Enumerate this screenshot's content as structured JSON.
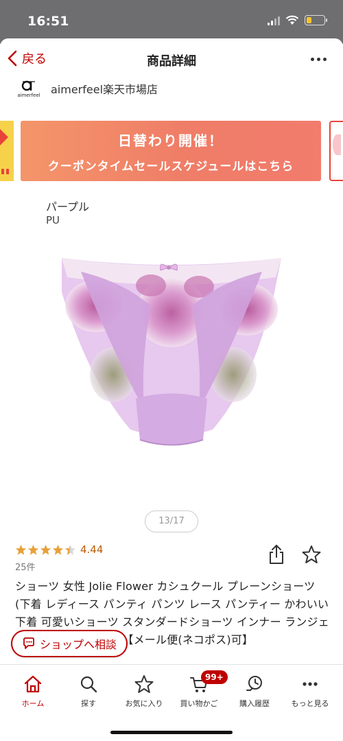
{
  "status_bar": {
    "time": "16:51",
    "battery_level": 0.3
  },
  "nav": {
    "back_label": "戻る",
    "title": "商品詳細"
  },
  "shop": {
    "logo_text": "aimerfeel",
    "name": "aimerfeel楽天市場店"
  },
  "banner": {
    "line1": "日替わり開催！",
    "line2": "クーポンタイムセールスケジュールはこちら"
  },
  "variant": {
    "color_name": "パープル",
    "color_code": "PU"
  },
  "gallery": {
    "indicator": "13/17"
  },
  "rating": {
    "value": "4.44",
    "stars": 4.44,
    "count": "25件"
  },
  "product": {
    "title": "ショーツ 女性 Jolie Flower カシュクール プレーンショーツ(下着 レディース パンティ パンツ レース パンティー かわいい下着 可愛いショーツ スタンダードショーツ インナー ランジェリー レースショーツ)【メール便(ネコポス)可】"
  },
  "consult_button": {
    "label": "ショップへ相談"
  },
  "tabs": [
    {
      "label": "ホーム",
      "icon": "home-icon",
      "active": true
    },
    {
      "label": "探す",
      "icon": "search-icon"
    },
    {
      "label": "お気に入り",
      "icon": "star-icon"
    },
    {
      "label": "買い物かご",
      "icon": "cart-icon",
      "badge": "99+"
    },
    {
      "label": "購入履歴",
      "icon": "history-icon"
    },
    {
      "label": "もっと見る",
      "icon": "more-icon"
    }
  ],
  "colors": {
    "accent": "#bf0000",
    "banner": "#ef7d67",
    "rating": "#e8a13a"
  }
}
